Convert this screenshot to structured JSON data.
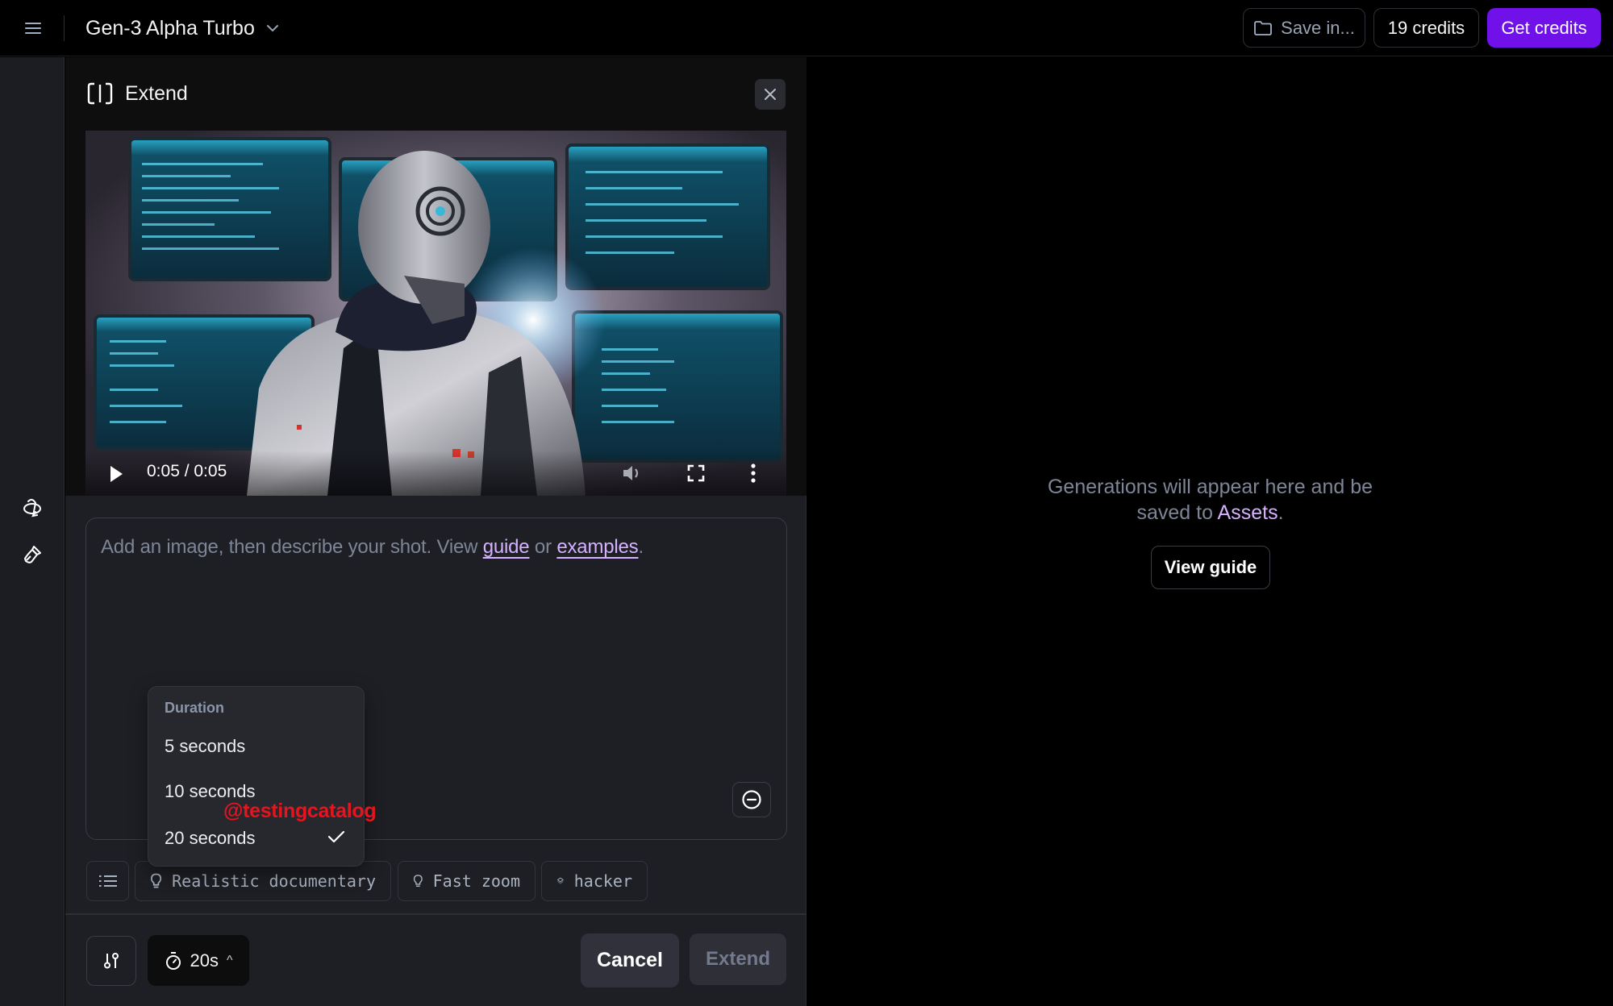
{
  "topbar": {
    "menu_icon": "hamburger-menu-icon",
    "model_name": "Gen-3 Alpha Turbo",
    "model_chevron_icon": "chevron-down-icon",
    "save_label": "Save in...",
    "save_icon": "folder-icon",
    "credits_label": "19 credits",
    "get_credits_label": "Get credits",
    "accent_color": "#6f11e8"
  },
  "rail": {
    "items": [
      {
        "icon": "3d-rotate-icon"
      },
      {
        "icon": "paintbrush-icon"
      }
    ]
  },
  "panel": {
    "title": "Extend",
    "title_icon": "extend-bracket-icon",
    "close_icon": "close-icon",
    "video": {
      "time_display": "0:05 / 0:05",
      "current_time": "0:05",
      "duration": "0:05",
      "play_icon": "play-icon",
      "volume_icon": "volume-icon",
      "fullscreen_icon": "fullscreen-icon",
      "more_icon": "more-vertical-icon"
    },
    "prompt": {
      "placeholder_prefix": "Add an image, then describe your shot. View ",
      "guide_link": "guide",
      "middle": " or ",
      "examples_link": "examples",
      "suffix": ".",
      "value": "",
      "link_color": "#d5b1ff",
      "clear_icon": "minus-circle-icon"
    },
    "chips": [
      {
        "icon": "list-icon",
        "label": ""
      },
      {
        "icon": "lightbulb-icon",
        "label": "Realistic documentary"
      },
      {
        "icon": "lightbulb-icon",
        "label": "Fast zoom"
      },
      {
        "icon": "layers-icon",
        "label": "hacker"
      }
    ],
    "footer": {
      "settings_icon": "sliders-icon",
      "duration_icon": "stopwatch-icon",
      "duration_label": "20s",
      "duration_caret": "^",
      "cancel_label": "Cancel",
      "extend_label": "Extend"
    },
    "duration_menu": {
      "label": "Duration",
      "options": [
        {
          "label": "5 seconds",
          "selected": false
        },
        {
          "label": "10 seconds",
          "selected": false
        },
        {
          "label": "20 seconds",
          "selected": true
        }
      ],
      "check_icon": "check-icon"
    }
  },
  "watermark": "@testingcatalog",
  "empty_state": {
    "line1": "Generations will appear here and be",
    "line2_prefix": "saved to ",
    "assets_link": "Assets",
    "line2_suffix": ".",
    "view_guide_label": "View guide"
  }
}
